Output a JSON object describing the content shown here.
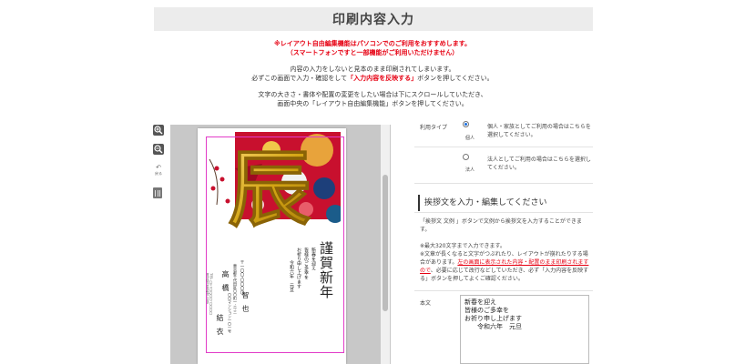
{
  "page": {
    "title": "印刷内容入力",
    "notice_red_1": "※レイアウト自由編集機能はパソコンでのご利用をおすすめします。",
    "notice_red_2": "（スマートフォンですと一部機能がご利用いただけません）",
    "info_1": "内容の入力をしないと見本のまま印刷されてしまいます。",
    "info_2_pre": "必ずこの画面で入力・確認をして",
    "info_2_red": "「入力内容を反映する」",
    "info_2_post": "ボタンを押してください。",
    "info_3": "文字の大きさ・書体や配置の変更をしたい場合は下にスクロールしていただき、",
    "info_4": "画面中央の「レイアウト自由編集機能」ボタンを押してください。"
  },
  "tools": {
    "zoom_in": "zoom-in-icon",
    "zoom_out": "zoom-out-icon",
    "undo_label": "戻る",
    "delete": "trash-icon"
  },
  "card": {
    "greeting_big": "謹賀新年",
    "message_lines": [
      "新春を迎え",
      "皆様のご多幸を",
      "お祈り申し上げます",
      "令和六年　元旦"
    ],
    "address_postal": "〒一〇〇-〇〇〇〇",
    "address_line1": "東京都千代田区〇〇町一-二-三",
    "address_line2": "〇〇マンション一〇一号",
    "name_family": "高橋",
    "name_given_1": "智也",
    "name_given_2": "結衣",
    "contact_line": "TEL 〇三-〇〇〇〇-〇〇〇〇",
    "contact_mail": "info@example.com"
  },
  "usage": {
    "label": "利用タイプ",
    "option_personal_short": "個人",
    "option_personal_desc": "個人・家族としてご利用の場合はこちらを選択してください。",
    "option_corporate_short": "法人",
    "option_corporate_desc": "法人としてご利用の場合はこちらを選択してください。",
    "selected": "personal"
  },
  "greeting": {
    "section_title": "挨拶文を入力・編集してください",
    "desc": "「挨拶文 文例 」ボタンで文例から挨拶文を入力することができます。",
    "note_1": "※最大320文字まで入力できます。",
    "note_2_pre": "※文章が長くなると文字がつぶれたり、レイアウトが崩れたりする場合があります。",
    "note_2_link": "左の画面に表示された内容・配置のまま印刷されますので",
    "note_2_post": "、必要に応じて改行などしていただき、必ず「入力内容を反映する」ボタンを押してよくご確認ください。",
    "body_label": "本文",
    "body_value": "新春を迎え\n皆様のご多幸を\nお祈り申し上げます\n　　令和六年　元旦"
  },
  "colors": {
    "accent_red": "#e60012",
    "safe_frame": "#e23cc8",
    "gold": "#d4a514",
    "kimono_red": "#c8102e"
  }
}
